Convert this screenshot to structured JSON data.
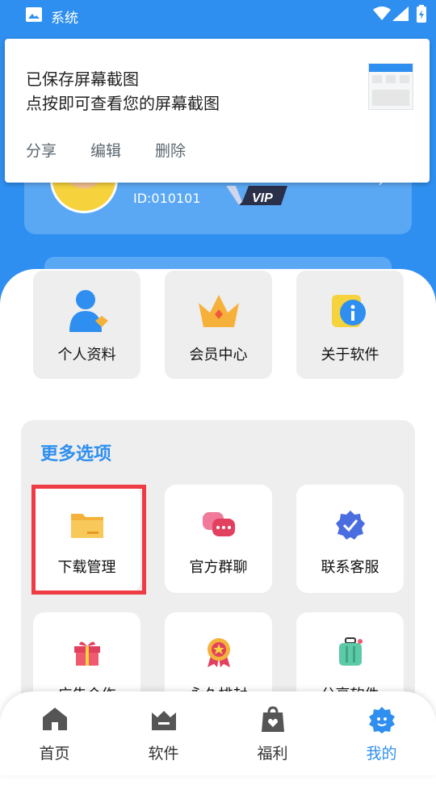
{
  "status_bar": {
    "app_name": "系统"
  },
  "notification": {
    "title": "已保存屏幕截图",
    "subtitle": "点按即可查看您的屏幕截图",
    "actions": [
      "分享",
      "编辑",
      "删除"
    ]
  },
  "profile": {
    "user_id": "ID:010101",
    "badge": "VIP"
  },
  "top_grid": [
    {
      "label": "个人资料",
      "icon": "profile-icon"
    },
    {
      "label": "会员中心",
      "icon": "crown-icon"
    },
    {
      "label": "关于软件",
      "icon": "info-icon"
    }
  ],
  "more_section": {
    "title": "更多选项",
    "items": [
      {
        "label": "下载管理",
        "icon": "folder-icon"
      },
      {
        "label": "官方群聊",
        "icon": "chat-bubbles-icon"
      },
      {
        "label": "联系客服",
        "icon": "verified-badge-icon"
      },
      {
        "label": "广告合作",
        "icon": "gift-icon"
      },
      {
        "label": "永久排封",
        "icon": "medal-icon"
      },
      {
        "label": "分享软件",
        "icon": "suitcase-icon"
      }
    ]
  },
  "bottom_nav": [
    {
      "label": "首页",
      "icon": "home-icon"
    },
    {
      "label": "软件",
      "icon": "software-icon"
    },
    {
      "label": "福利",
      "icon": "gift-bag-icon"
    },
    {
      "label": "我的",
      "icon": "mine-icon",
      "active": true
    }
  ],
  "colors": {
    "primary": "#2f8ff0",
    "highlight": "#ef3b44",
    "tile_bg": "#eeeeee"
  }
}
